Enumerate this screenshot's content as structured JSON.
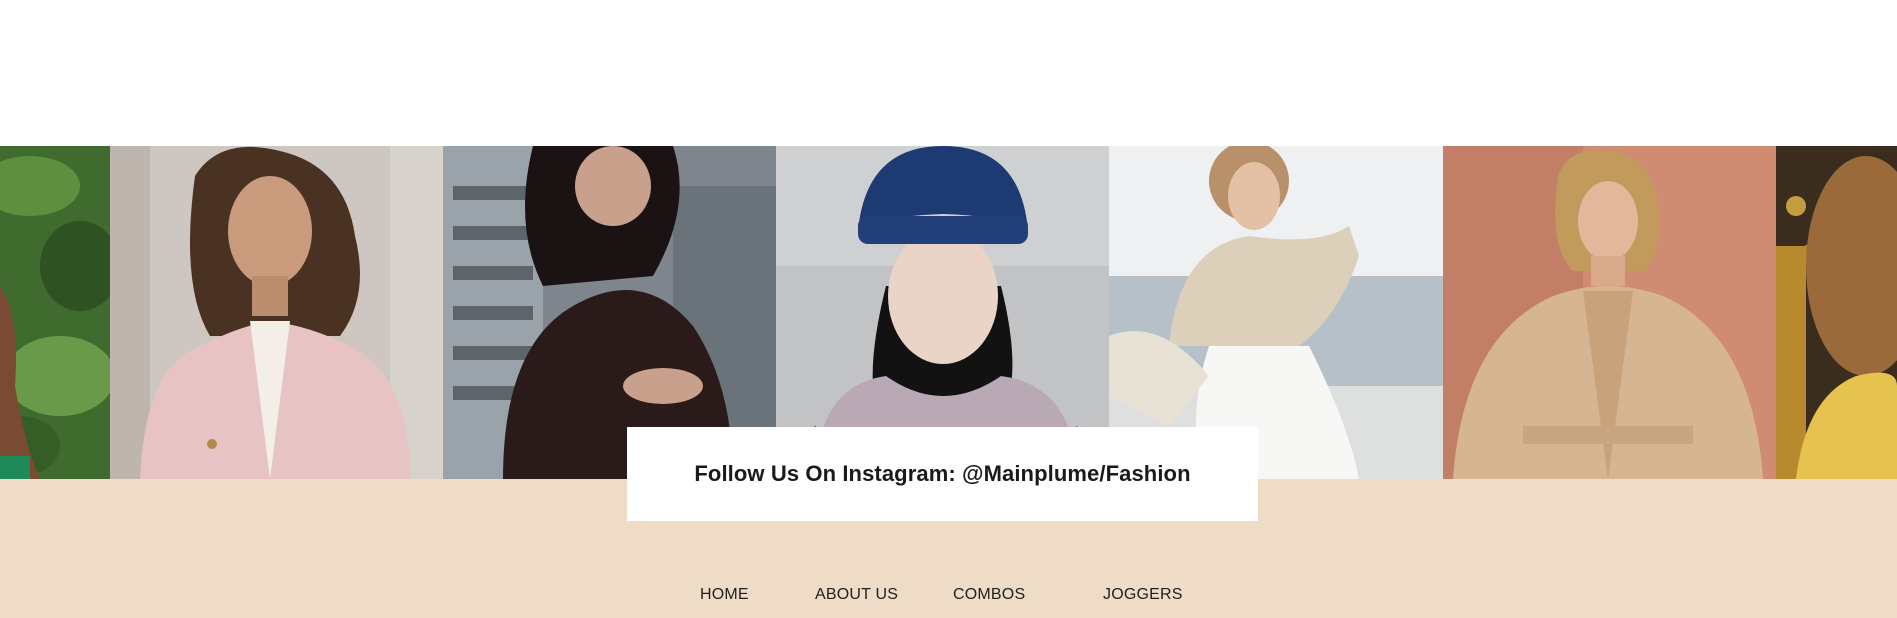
{
  "instagram": {
    "label": "Follow Us On Instagram: @Mainplume/Fashion"
  },
  "nav": {
    "items": [
      "HOME",
      "ABOUT US",
      "COMBOS",
      "JOGGERS"
    ]
  },
  "gallery": {
    "photos": [
      "photo-tropical-leaves",
      "photo-pink-coat",
      "photo-leather-jacket",
      "photo-navy-beanie-scarf",
      "photo-beige-blouse-seaside",
      "photo-trench-coat",
      "photo-curly-hair-yellow"
    ]
  },
  "colors": {
    "footer_background": "#eedcc6",
    "card_background": "#ffffff",
    "text": "#1a1a1a"
  }
}
